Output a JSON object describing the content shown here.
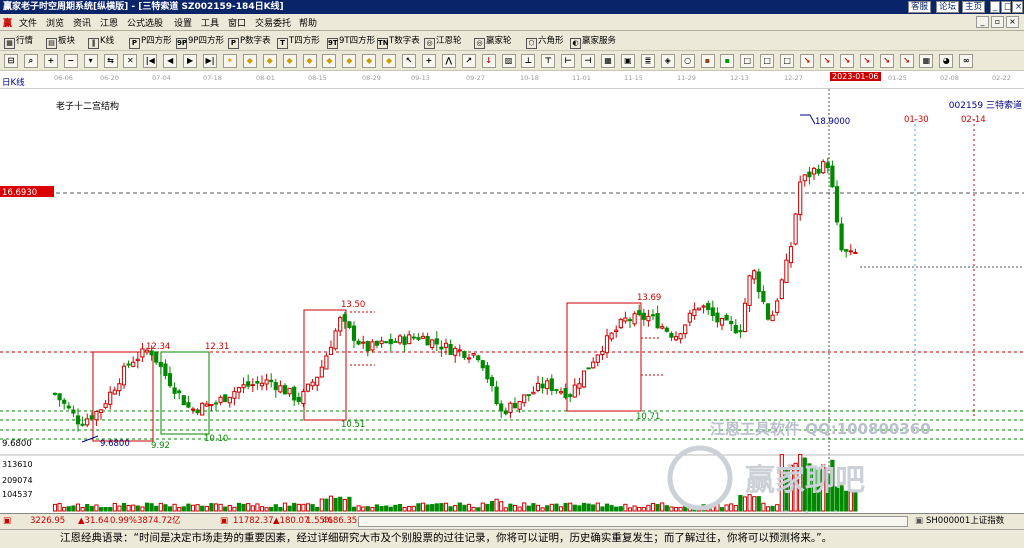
{
  "app": {
    "title": "赢家老子时空周期系统[纵横版] - [三特索道  SZ002159-184日K线]",
    "title_links": [
      "客服",
      "论坛",
      "主页"
    ]
  },
  "menu": [
    "文件",
    "浏览",
    "资讯",
    "江恩",
    "公式选股",
    "设置",
    "工具",
    "窗口",
    "交易委托",
    "帮助"
  ],
  "window_controls": [
    "_",
    "▫",
    "×"
  ],
  "toolbar1": [
    {
      "icon": "grid-icon",
      "glyph": "▦",
      "label": "行情"
    },
    {
      "icon": "block-icon",
      "glyph": "▤",
      "label": "板块"
    },
    {
      "icon": "candle-icon",
      "glyph": "‖",
      "label": "K线"
    },
    {
      "icon": "p-square-icon",
      "glyph": "P",
      "label": "P四方形"
    },
    {
      "icon": "9p-square-icon",
      "glyph": "9P",
      "label": "9P四方形"
    },
    {
      "icon": "p-number-icon",
      "glyph": "P",
      "label": "P数字表"
    },
    {
      "icon": "t-square-icon",
      "glyph": "T",
      "label": "T四方形"
    },
    {
      "icon": "9t-square-icon",
      "glyph": "9T",
      "label": "9T四方形"
    },
    {
      "icon": "t-number-icon",
      "glyph": "TN",
      "label": "T数字表"
    },
    {
      "icon": "gann-wheel-icon",
      "glyph": "◎",
      "label": "江恩轮"
    },
    {
      "icon": "winner-wheel-icon",
      "glyph": "◎",
      "label": "赢家轮"
    },
    {
      "icon": "hexagon-icon",
      "glyph": "⬡",
      "label": "六角形"
    },
    {
      "icon": "service-icon",
      "glyph": "◐",
      "label": "赢家服务"
    }
  ],
  "toolbar2_icons": [
    "layout",
    "find",
    "zoom-in",
    "zoom-out",
    "dropdown",
    "compare",
    "x-mark",
    "first",
    "prev",
    "play",
    "next",
    "star",
    "diamond",
    "diamond",
    "diamond",
    "diamond",
    "diamond",
    "diamond",
    "diamond",
    "diamond",
    "cursor",
    "crosshair",
    "zigzag",
    "arrow",
    "red-down",
    "color",
    "bar-a",
    "bar-b",
    "bar-c",
    "bar-d",
    "table",
    "photo",
    "layers",
    "palette",
    "circle",
    "brown",
    "green",
    "box",
    "box",
    "box",
    "red-arrow",
    "red-arrow",
    "red-arrow",
    "red-arrow",
    "red-arrow",
    "red-arrow",
    "grid",
    "color-wheel",
    "wave"
  ],
  "chart": {
    "period_label": "日K线",
    "title": "老子十二宫结构",
    "stock_label": "002159  三特索道",
    "dates": [
      "06-06",
      "06-20",
      "07-04",
      "07-18",
      "08-01",
      "08-15",
      "08-29",
      "09-13",
      "09-27",
      "10-18",
      "11-01",
      "11-15",
      "11-29",
      "12-13",
      "12-27",
      "2023-01-06",
      "01-25",
      "02-08",
      "02-22"
    ],
    "cursor_date": "2023-01-06",
    "cursor_price": "16.6930",
    "price_labels": [
      "18.9000",
      "13.69",
      "13.50",
      "12.34",
      "12.31",
      "10.71",
      "10.51",
      "10.10",
      "9.92",
      "9.6800",
      "9.6800"
    ],
    "projection_dates": [
      "01-30",
      "02-14"
    ],
    "volume_ticks": [
      "313610",
      "209074",
      "104537"
    ],
    "watermark": "江恩工具软件 QQ:100800360",
    "logo_text": "赢家聊吧",
    "logo_url": "jiaoba.vip"
  },
  "chart_data": {
    "type": "candlestick",
    "ylim": [
      9.2,
      19.5
    ],
    "marks": {
      "high": 18.9,
      "low": 9.68,
      "cursor": 16.693
    }
  },
  "status": {
    "sh_index": "3226.95",
    "sh_change": "▲31.64",
    "sh_pct": "0.99%",
    "sh_amount": "3874.72亿",
    "sz_index": "11782.37",
    "sz_change": "▲180.07",
    "sz_pct": "1.55%",
    "sz_amount": "4686.35",
    "right": "SH000001上证指数"
  },
  "quote": "江恩经典语录：“时间是决定市场走势的重要因素，经过详细研究大市及个别股票的过往记录，你将可以证明，历史确实重复发生；而了解过往，你将可以预测将来。”。"
}
